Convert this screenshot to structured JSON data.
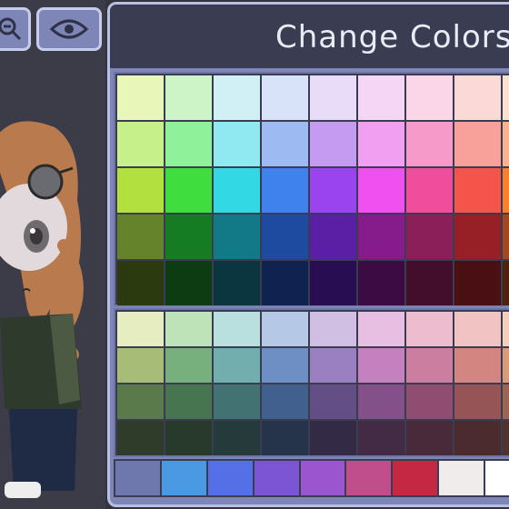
{
  "panel": {
    "title": "Change Colors"
  },
  "top_buttons": [
    {
      "icon": "zoom-icon"
    },
    {
      "icon": "eye-icon"
    }
  ],
  "palette_top": [
    [
      "#e9f6b9",
      "#cdf4c6",
      "#d0f0f5",
      "#d8e2f8",
      "#e8dcf8",
      "#f5d6f5",
      "#fad6e8",
      "#fbd9d6",
      "#fbe1cf"
    ],
    [
      "#c6f08a",
      "#8ff19a",
      "#90e8f0",
      "#9dbaf3",
      "#c59af1",
      "#f19ff0",
      "#f59ac9",
      "#f8a19b",
      "#f9b48f"
    ],
    [
      "#b1e03f",
      "#3fde3e",
      "#32d8e4",
      "#3f82ee",
      "#9a44f0",
      "#ef50ef",
      "#f04d9c",
      "#f4554b",
      "#f5812f"
    ],
    [
      "#64832b",
      "#157c24",
      "#127a86",
      "#1e4aa0",
      "#5a1fa5",
      "#861c8c",
      "#8b1f5a",
      "#962025",
      "#a3481d"
    ],
    [
      "#2c3a10",
      "#0d3b12",
      "#0b3640",
      "#0f2250",
      "#280d52",
      "#3d0b44",
      "#430e2c",
      "#4a0f12",
      "#4e230d"
    ]
  ],
  "palette_mid": [
    [
      "#e5edc1",
      "#bfe3b9",
      "#b9e0df",
      "#b5c9e7",
      "#d0bfe3",
      "#e6bfe2",
      "#edbdcf",
      "#f1c3c2",
      "#f3cdbd"
    ],
    [
      "#a7bd77",
      "#77b07c",
      "#73aeae",
      "#6e8fc3",
      "#9a80c1",
      "#c480bf",
      "#cc7ea0",
      "#d38681",
      "#d79a7b"
    ],
    [
      "#5b7a4b",
      "#46754f",
      "#427272",
      "#42608e",
      "#634f86",
      "#84508a",
      "#8f4e71",
      "#975457",
      "#9b6452"
    ],
    [
      "#2f3c2a",
      "#273a2c",
      "#243a3b",
      "#25344a",
      "#332b46",
      "#432b46",
      "#492a3b",
      "#4b2b2d",
      "#4d332b"
    ]
  ],
  "palette_bottom": [
    "#6f78ad",
    "#4a99e3",
    "#5570e6",
    "#7c55d4",
    "#9a55cf",
    "#c04e8c",
    "#c42843",
    "#f0ecec",
    "#ffffff"
  ]
}
